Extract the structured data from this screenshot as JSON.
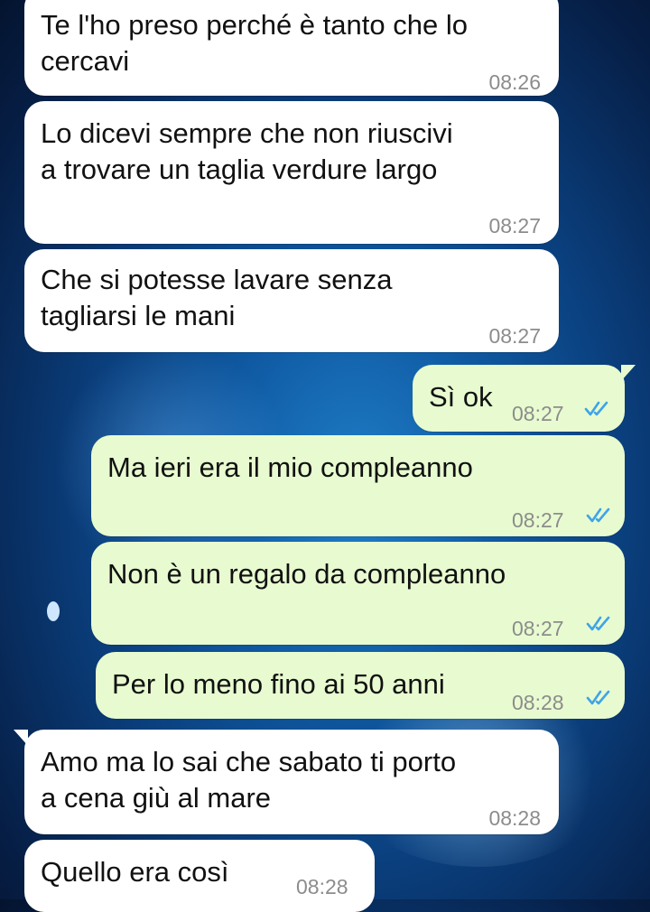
{
  "messages": [
    {
      "lines": [
        "Te l'ho preso perché è tanto che lo",
        "cercavi"
      ],
      "time": "08:26"
    },
    {
      "lines": [
        "Lo dicevi sempre che non riuscivi",
        "a trovare un taglia verdure largo"
      ],
      "time": "08:27"
    },
    {
      "lines": [
        "Che si potesse lavare senza",
        "tagliarsi le mani"
      ],
      "time": "08:27"
    },
    {
      "lines": [
        "Sì ok"
      ],
      "time": "08:27",
      "status": "read"
    },
    {
      "lines": [
        "Ma ieri era il mio compleanno"
      ],
      "time": "08:27",
      "status": "read"
    },
    {
      "lines": [
        "Non è un regalo da compleanno"
      ],
      "time": "08:27",
      "status": "read"
    },
    {
      "lines": [
        "Per lo meno fino ai 50 anni"
      ],
      "time": "08:28",
      "status": "read"
    },
    {
      "lines": [
        "Amo ma lo sai che sabato ti porto",
        "a cena giù al mare"
      ],
      "time": "08:28"
    },
    {
      "lines": [
        "Quello era così"
      ],
      "time": "08:28"
    }
  ],
  "colors": {
    "incoming_bubble": "#ffffff",
    "outgoing_bubble": "#e8fbd0",
    "read_ticks": "#3fa4e8",
    "timestamp": "#8c8c8c"
  },
  "icons": {
    "read_receipt": "double-check-icon"
  }
}
